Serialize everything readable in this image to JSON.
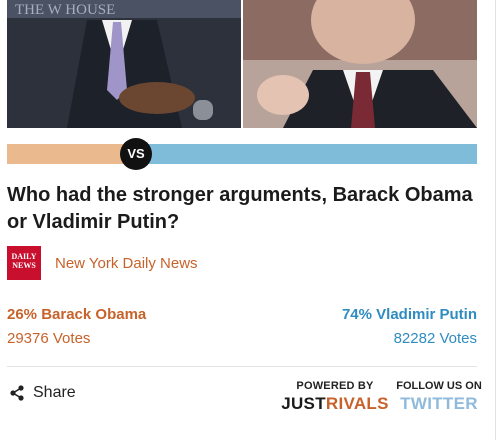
{
  "colors": {
    "obama_accent": "#c7622b",
    "obama_bar": "#ebb98e",
    "putin_accent": "#2f8cc0",
    "putin_bar": "#7fbcd9",
    "twitter": "#8fbadc"
  },
  "poll": {
    "vs_label": "VS",
    "question": "Who had the stronger arguments, Barack Obama or Vladimir Putin?",
    "source_logo_text": "DAILY NEWS",
    "source_name": "New York Daily News",
    "left": {
      "percent": 26,
      "label": "26% Barack Obama",
      "votes": "29376 Votes"
    },
    "right": {
      "percent": 74,
      "label": "74% Vladimir Putin",
      "votes": "82282 Votes"
    }
  },
  "footer": {
    "share_label": "Share",
    "powered_by_label": "POWERED BY",
    "brand_part1": "JUST",
    "brand_part2": "RIVALS",
    "follow_label": "FOLLOW US ON",
    "twitter_label": "TWITTER"
  }
}
